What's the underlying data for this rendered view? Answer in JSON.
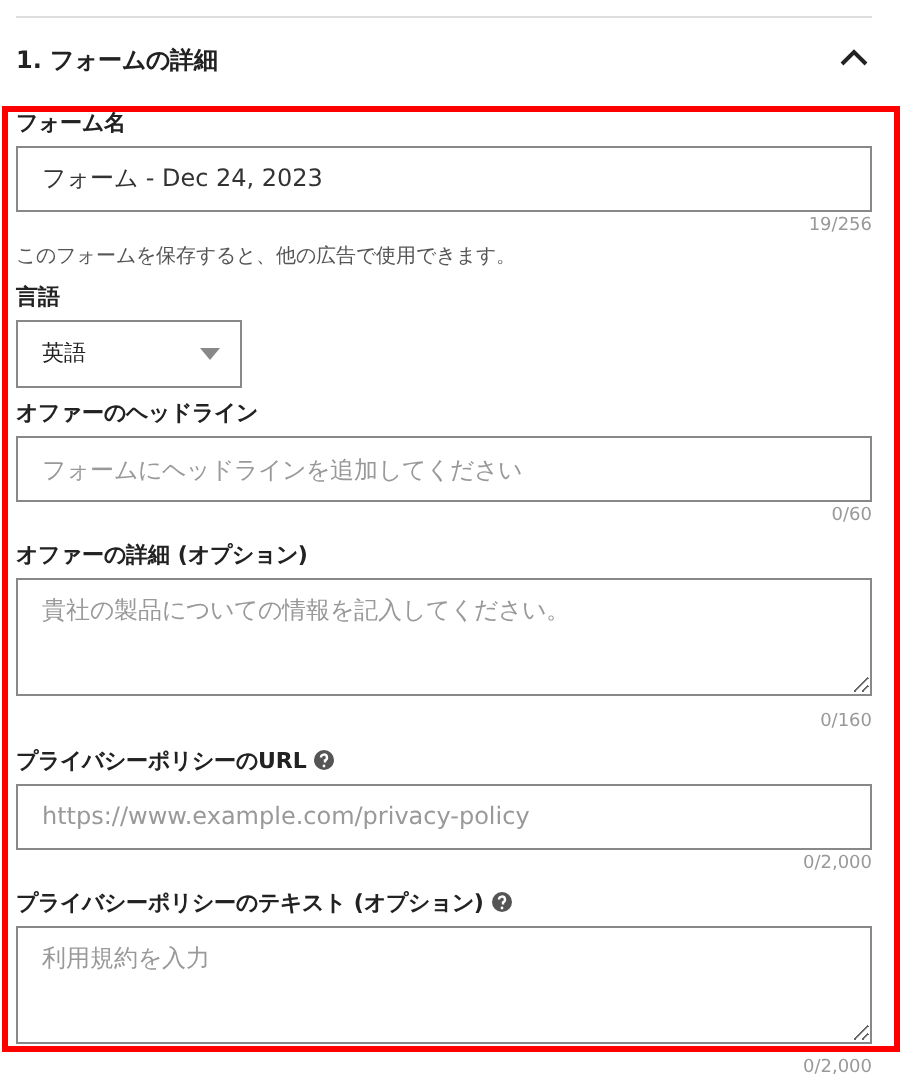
{
  "section": {
    "title": "1. フォームの詳細",
    "expanded": true,
    "highlighted": true
  },
  "fields": [
    {
      "kind": "text",
      "label": "フォーム名",
      "info": false,
      "value": "フォーム - Dec 24, 2023",
      "counter": "19/256",
      "hint": "このフォームを保存すると、他の広告で使用できます。"
    },
    {
      "kind": "select",
      "label": "言語",
      "info": false,
      "value": "英語"
    },
    {
      "kind": "text",
      "label": "オファーのヘッドライン",
      "info": false,
      "placeholder": "フォームにヘッドラインを追加してください",
      "counter": "0/60"
    },
    {
      "kind": "textarea",
      "label": "オファーの詳細 (オプション)",
      "info": false,
      "placeholder": "貴社の製品についての情報を記入してください。",
      "counter": "0/160"
    },
    {
      "kind": "text",
      "label": "プライバシーポリシーのURL",
      "info": true,
      "placeholder": "https://www.example.com/privacy-policy",
      "counter": "0/2,000"
    },
    {
      "kind": "textarea",
      "label": "プライバシーポリシーのテキスト (オプション)",
      "info": true,
      "placeholder": "利用規約を入力",
      "counter": "0/2,000"
    }
  ]
}
